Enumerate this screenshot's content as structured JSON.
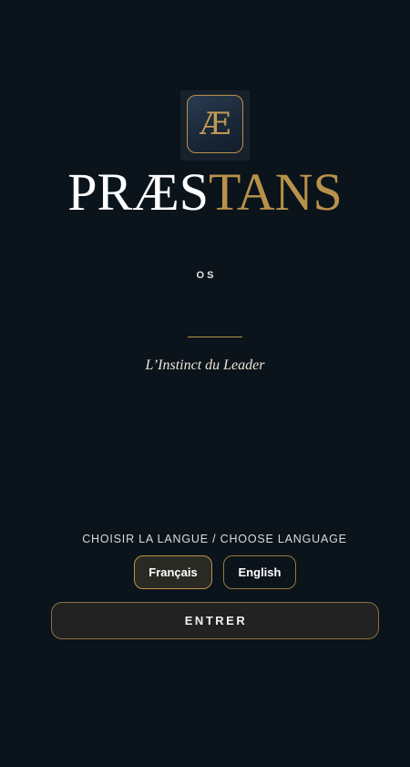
{
  "brand": {
    "logo_mark_text": "Æ",
    "logo_icon": "ae-ligature-logo-icon",
    "wordmark_primary": "PRÆS",
    "wordmark_accent": "TANS",
    "subtitle": "OS",
    "tagline": "L’Instinct du Leader"
  },
  "language": {
    "heading": "CHOISIR LA LANGUE / CHOOSE LANGUAGE",
    "options": [
      {
        "label": "Français",
        "selected": true
      },
      {
        "label": "English",
        "selected": false
      }
    ]
  },
  "actions": {
    "enter_label": "ENTRER"
  },
  "colors": {
    "background": "#0b131b",
    "gold": "#b8924a",
    "text": "#ffffff",
    "button_fill": "#222222"
  }
}
